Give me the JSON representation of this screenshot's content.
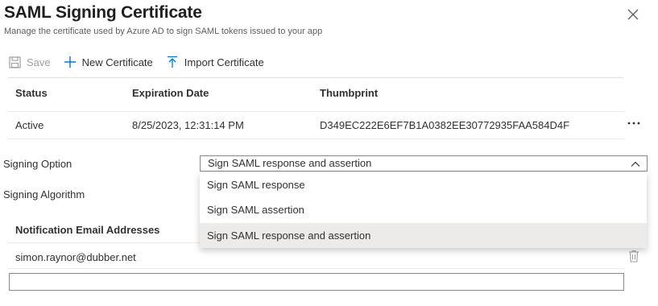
{
  "header": {
    "title": "SAML Signing Certificate",
    "subtitle": "Manage the certificate used by Azure AD to sign SAML tokens issued to your app",
    "close_icon": "close-icon"
  },
  "toolbar": {
    "save_label": "Save",
    "new_certificate_label": "New Certificate",
    "import_certificate_label": "Import Certificate"
  },
  "certificates": {
    "columns": [
      "Status",
      "Expiration Date",
      "Thumbprint"
    ],
    "rows": [
      {
        "status": "Active",
        "expiration": "8/25/2023, 12:31:14 PM",
        "thumbprint": "D349EC222E6EF7B1A0382EE30772935FAA584D4F"
      }
    ]
  },
  "signing_option": {
    "label": "Signing Option",
    "selected": "Sign SAML response and assertion",
    "options": [
      "Sign SAML response",
      "Sign SAML assertion",
      "Sign SAML response and assertion"
    ]
  },
  "signing_algorithm": {
    "label": "Signing Algorithm"
  },
  "notification": {
    "header": "Notification Email Addresses",
    "emails": [
      "simon.raynor@dubber.net"
    ],
    "new_email_value": ""
  }
}
